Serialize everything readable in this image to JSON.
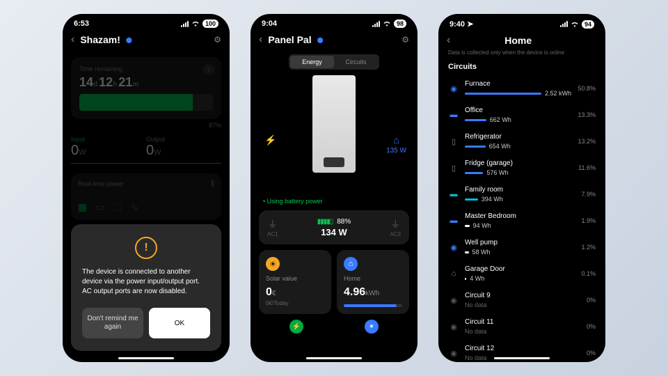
{
  "p1": {
    "status": {
      "time": "6:53",
      "battery": "100"
    },
    "header": {
      "title": "Shazam!"
    },
    "time_remaining": {
      "label": "Time remaining",
      "days": "14",
      "hours": "12",
      "mins": "21",
      "pct": "87%"
    },
    "input": {
      "label": "Input",
      "value": "0",
      "unit": "W"
    },
    "output": {
      "label": "Output",
      "value": "0",
      "unit": "W"
    },
    "realtime_label": "Real-time power",
    "modal": {
      "text": "The device is connected to another device via the power input/output port. AC output ports are now disabled.",
      "dont_remind": "Don't remind me again",
      "ok": "OK"
    }
  },
  "p2": {
    "status": {
      "time": "9:04",
      "battery": "98"
    },
    "header": {
      "title": "Panel Pal"
    },
    "tabs": {
      "energy": "Energy",
      "circuits": "Circuits"
    },
    "home_watts": "135 W",
    "using": "Using battery power",
    "ac": {
      "ac1": "AC1",
      "ac3": "AC3",
      "pct": "88%",
      "watts": "134 W"
    },
    "solar": {
      "label": "Solar value",
      "value": "0",
      "unit": "€",
      "sub": "0€/Today"
    },
    "home": {
      "label": "Home",
      "value": "4.96",
      "unit": "kWh"
    }
  },
  "p3": {
    "status": {
      "time": "9:40",
      "battery": "94"
    },
    "header": {
      "title": "Home"
    },
    "note": "Data is collected only when the device is online",
    "section": "Circuits",
    "circuits": [
      {
        "name": "Furnace",
        "value": "2.52 kWh",
        "pct": "50.8%",
        "bar": 100,
        "color": "#3a7bff",
        "icon": "◉",
        "ic_color": "#3a7bff"
      },
      {
        "name": "Office",
        "value": "662 Wh",
        "pct": "13.3%",
        "bar": 28,
        "color": "#3a7bff",
        "icon": "▬",
        "ic_color": "#3a7bff"
      },
      {
        "name": "Refrigerator",
        "value": "654 Wh",
        "pct": "13.2%",
        "bar": 27,
        "color": "#3a7bff",
        "icon": "▯",
        "ic_color": "#888"
      },
      {
        "name": "Fridge (garage)",
        "value": "576 Wh",
        "pct": "11.6%",
        "bar": 24,
        "color": "#3a7bff",
        "icon": "▯",
        "ic_color": "#888"
      },
      {
        "name": "Family room",
        "value": "394 Wh",
        "pct": "7.9%",
        "bar": 17,
        "color": "#00bcd4",
        "icon": "▬",
        "ic_color": "#00bcd4"
      },
      {
        "name": "Master Bedroom",
        "value": "94 Wh",
        "pct": "1.9%",
        "bar": 6,
        "color": "#fff",
        "icon": "▬",
        "ic_color": "#3a7bff"
      },
      {
        "name": "Well pump",
        "value": "58 Wh",
        "pct": "1.2%",
        "bar": 5,
        "color": "#fff",
        "icon": "◉",
        "ic_color": "#3a7bff"
      },
      {
        "name": "Garage Door",
        "value": "4 Wh",
        "pct": "0.1%",
        "bar": 2,
        "color": "#fff",
        "icon": "⌂",
        "ic_color": "#888"
      },
      {
        "name": "Circuit 9",
        "value": "No data",
        "pct": "0%",
        "nodata": true,
        "icon": "◉",
        "ic_color": "#555"
      },
      {
        "name": "Circuit 11",
        "value": "No data",
        "pct": "0%",
        "nodata": true,
        "icon": "◉",
        "ic_color": "#555"
      },
      {
        "name": "Circuit 12",
        "value": "No data",
        "pct": "0%",
        "nodata": true,
        "icon": "◉",
        "ic_color": "#555"
      }
    ]
  }
}
